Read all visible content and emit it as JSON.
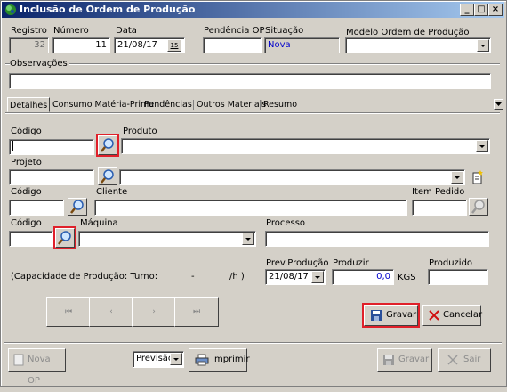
{
  "window": {
    "title": "Inclusão de Ordem de Produção",
    "controls": {
      "minimize": "_",
      "maximize": "□",
      "close": "×"
    }
  },
  "header": {
    "registro_label": "Registro",
    "registro_value": "32",
    "numero_label": "Número",
    "numero_value": "11",
    "data_label": "Data",
    "data_value": "21/08/17",
    "calendar_label": "15",
    "pendencia_label": "Pendência OP",
    "pendencia_value": "",
    "situacao_label": "Situação",
    "situacao_value": "Nova",
    "modelo_label": "Modelo Ordem de Produção",
    "modelo_value": "",
    "observacoes_label": "Observações",
    "observacoes_value": ""
  },
  "tabs": [
    "Detalhes",
    "Consumo Matéria-Prima",
    "Pendências",
    "Outros Materiais",
    "Resumo"
  ],
  "detalhes": {
    "codigo1_label": "Código",
    "produto_label": "Produto",
    "projeto_label": "Projeto",
    "codigo2_label": "Código",
    "cliente_label": "Cliente",
    "item_pedido_label": "Item Pedido",
    "codigo3_label": "Código",
    "maquina_label": "Máquina",
    "processo_label": "Processo",
    "capacidade_label": "(Capacidade de Produção: Turno:",
    "capacidade_dash": "-",
    "capacidade_unit": "/h )",
    "prev_producao_label": "Prev.Produção",
    "prev_producao_value": "21/08/17",
    "produzir_label": "Produzir",
    "produzir_value": "0,0",
    "produzir_unit": "KGS",
    "produzido_label": "Produzido",
    "produzido_value": ""
  },
  "nav": {
    "first": "⏮",
    "prev": "‹",
    "next": "›",
    "last": "⏭"
  },
  "actions": {
    "gravar": "Gravar",
    "cancelar": "Cancelar"
  },
  "footer": {
    "nova_op": "Nova OP",
    "previsao": "Previsão",
    "imprimir": "Imprimir",
    "gravar": "Gravar",
    "sair": "Sair"
  },
  "colors": {
    "highlight": "#e0202a",
    "title_start": "#0a246a",
    "title_end": "#a6caf0",
    "situacao_text": "#0000cc"
  }
}
